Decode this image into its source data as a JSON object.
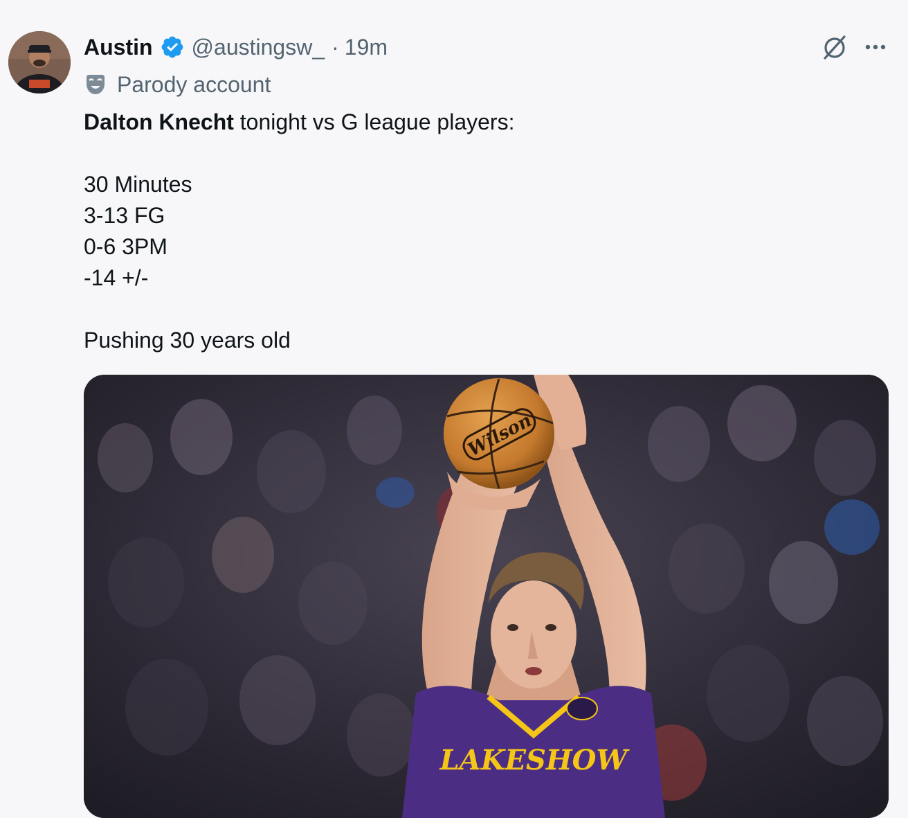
{
  "tweet": {
    "author": {
      "display_name": "Austin",
      "handle": "@austingsw_",
      "separator": "·",
      "time": "19m",
      "verified_icon": "verified-badge-icon",
      "label_icon": "parody-mask-icon",
      "label": "Parody account"
    },
    "actions": {
      "grok_icon": "grok-icon",
      "more_icon": "more-icon"
    },
    "text": {
      "mention": "Dalton Knecht",
      "intro_rest": " tonight vs G league players:",
      "stats": [
        "30 Minutes",
        "3-13 FG",
        "0-6 3PM",
        "-14 +/-"
      ],
      "closing": "Pushing 30 years old"
    },
    "media": {
      "ball_brand": "Wilson",
      "jersey_text": "LAKESHOW"
    },
    "colors": {
      "verified": "#1d9bf0",
      "text_primary": "#0f1419",
      "text_secondary": "#536471",
      "jersey_purple": "#4b2e83",
      "jersey_gold": "#f5c518"
    }
  }
}
